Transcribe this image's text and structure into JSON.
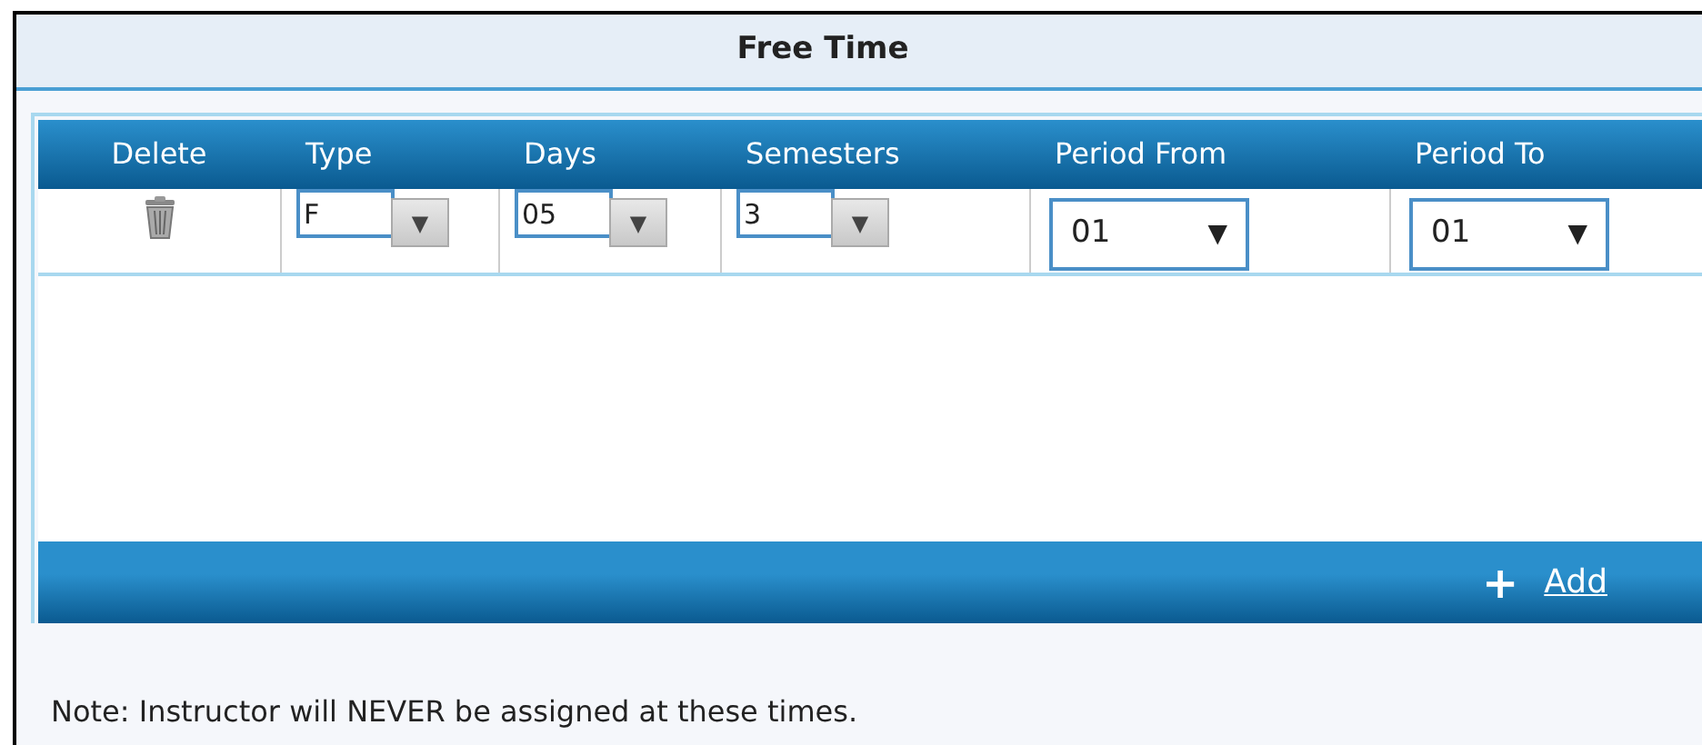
{
  "panel": {
    "title": "Free Time"
  },
  "table": {
    "columns": [
      "Delete",
      "Type",
      "Days",
      "Semesters",
      "Period From",
      "Period To"
    ],
    "rows": [
      {
        "cells": [
          {
            "kind": "delete"
          },
          {
            "kind": "combo",
            "value": "F",
            "arrow": "▼"
          },
          {
            "kind": "combo",
            "value": "05",
            "arrow": "▼"
          },
          {
            "kind": "combo",
            "value": "3",
            "arrow": "▼"
          },
          {
            "kind": "select",
            "value": "01",
            "arrow": "▼"
          },
          {
            "kind": "select",
            "value": "01",
            "arrow": "▼"
          }
        ]
      }
    ]
  },
  "add": {
    "icon": "+",
    "label": "Add"
  },
  "note": "Note: Instructor will NEVER be assigned at these times."
}
